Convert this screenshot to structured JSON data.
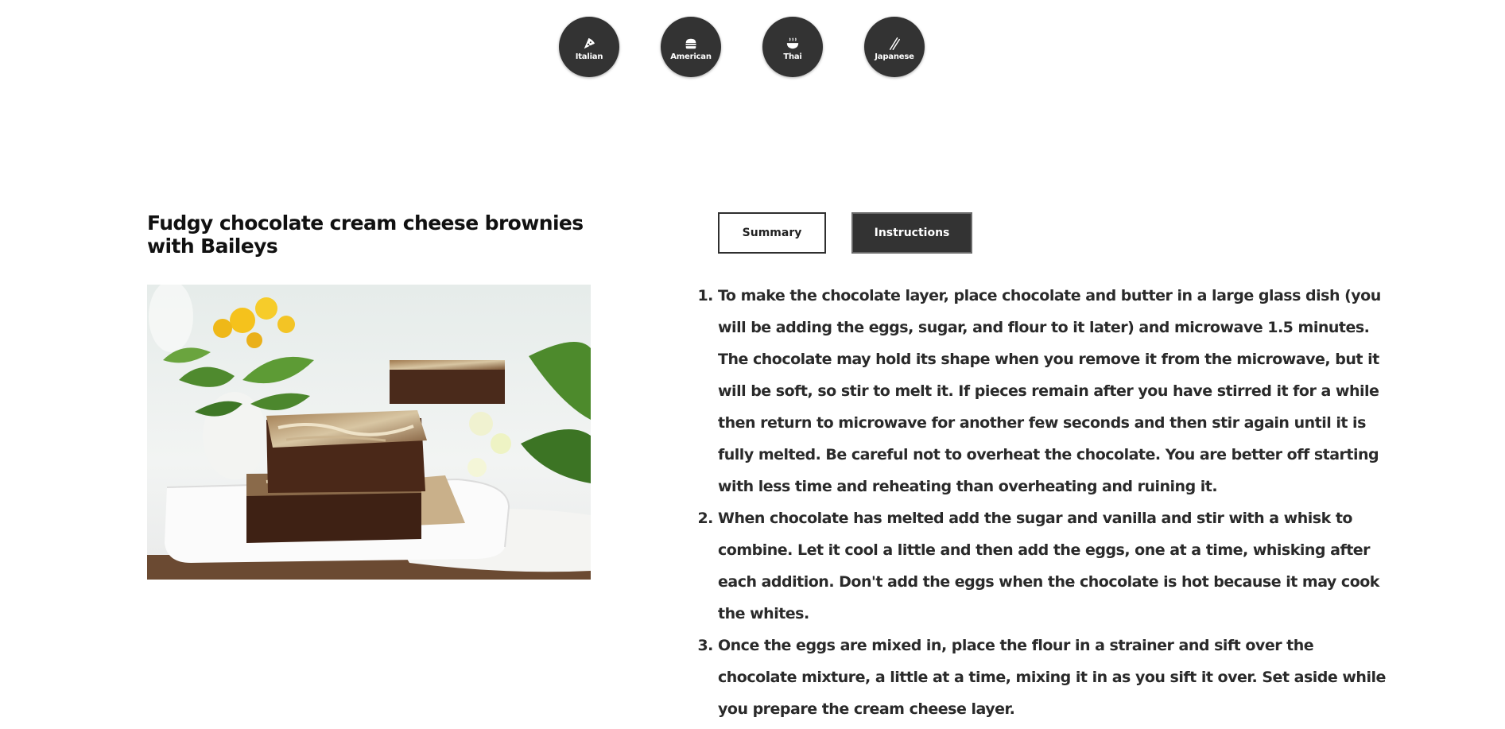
{
  "cuisines": [
    {
      "label": "Italian",
      "icon": "pizza-icon"
    },
    {
      "label": "American",
      "icon": "burger-icon"
    },
    {
      "label": "Thai",
      "icon": "noodle-bowl-icon"
    },
    {
      "label": "Japanese",
      "icon": "chopsticks-icon"
    }
  ],
  "recipe": {
    "title": "Fudgy chocolate cream cheese brownies with Baileys"
  },
  "tabs": {
    "summary": "Summary",
    "instructions": "Instructions",
    "active": "Instructions"
  },
  "instructions": [
    "To make the chocolate layer, place chocolate and butter in a large glass dish (you will be adding the eggs, sugar, and flour to it later) and microwave 1.5 minutes. The chocolate may hold its shape when you remove it from the microwave, but it will be soft, so stir to melt it. If pieces remain after you have stirred it for a while then return to microwave for another few seconds and then stir again until it is fully melted. Be careful not to overheat the chocolate. You are better off starting with less time and reheating than overheating and ruining it.",
    "When chocolate has melted add the sugar and vanilla and stir with a whisk to combine. Let it cool a little and then add the eggs, one at a time, whisking after each addition. Don't add the eggs when the chocolate is hot because it may cook the whites.",
    "Once the eggs are mixed in, place the flour in a strainer and sift over the chocolate mixture, a little at a time, mixing it in as you sift it over. Set aside while you prepare the cream cheese layer."
  ],
  "colors": {
    "dark": "#333333",
    "text": "#2a2a2a",
    "background": "#ffffff"
  }
}
